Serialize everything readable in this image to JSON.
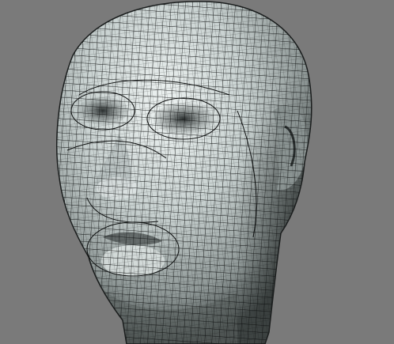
{
  "viewport": {
    "background_color": "#7a7a7a",
    "model": {
      "subject": "head-wireframe-model",
      "shading": "smooth-shaded-with-wireframe-overlay",
      "surface_color": "#c8d0cf",
      "wire_color": "#0d0f0f"
    }
  }
}
